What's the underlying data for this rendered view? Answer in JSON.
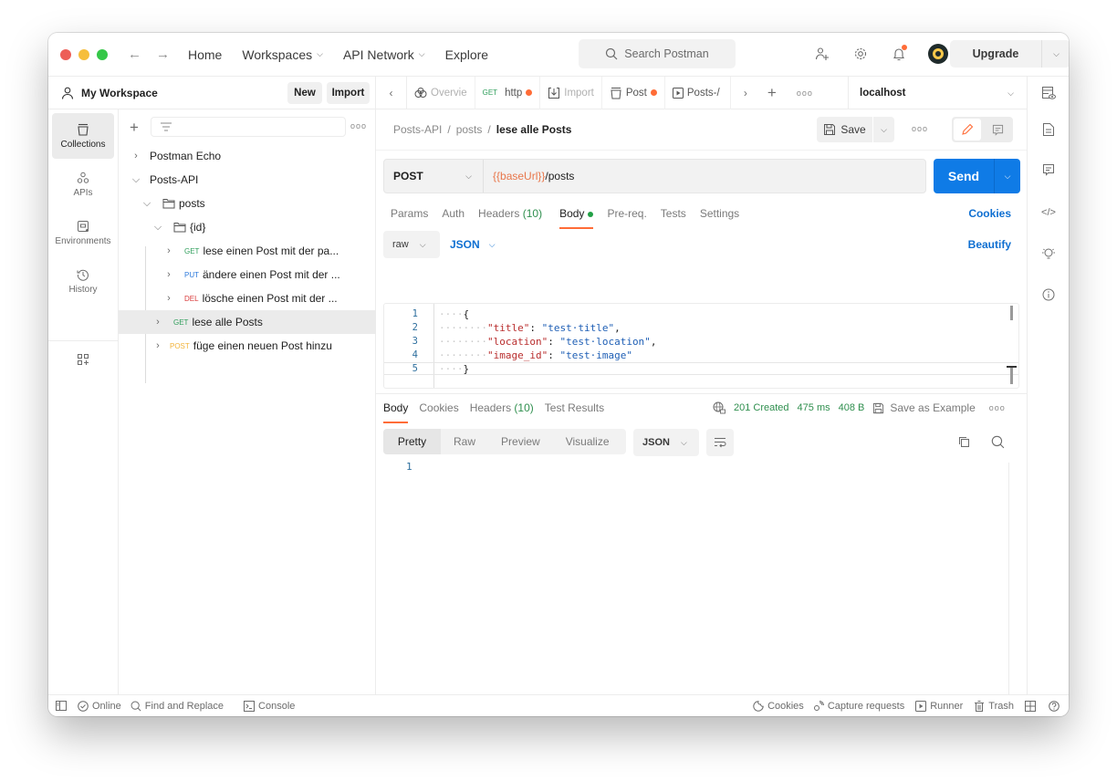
{
  "titlebar": {
    "nav": [
      {
        "label": "Home",
        "has_dropdown": false
      },
      {
        "label": "Workspaces",
        "has_dropdown": true
      },
      {
        "label": "API Network",
        "has_dropdown": true
      },
      {
        "label": "Explore",
        "has_dropdown": false
      }
    ],
    "search_placeholder": "Search Postman",
    "upgrade_label": "Upgrade",
    "icons": [
      "invite-user-icon",
      "settings-gear-icon",
      "notification-bell-icon",
      "avatar"
    ]
  },
  "workspace": {
    "title": "My Workspace",
    "new_label": "New",
    "import_label": "Import"
  },
  "left_rail": [
    {
      "label": "Collections",
      "icon": "collections-icon",
      "active": true
    },
    {
      "label": "APIs",
      "icon": "apis-icon",
      "active": false
    },
    {
      "label": "Environments",
      "icon": "environments-icon",
      "active": false
    },
    {
      "label": "History",
      "icon": "history-icon",
      "active": false
    }
  ],
  "tree": {
    "items": [
      {
        "label": "Postman Echo",
        "caret": ">",
        "method": ""
      },
      {
        "label": "Posts-API",
        "caret": "v",
        "method": ""
      },
      {
        "label": "posts",
        "caret": "v",
        "method": "",
        "folder": true
      },
      {
        "label": "{id}",
        "caret": "v",
        "method": "",
        "folder": true
      },
      {
        "label": "lese einen Post mit der pa...",
        "caret": ">",
        "method": "GET"
      },
      {
        "label": "ändere einen Post mit der ...",
        "caret": ">",
        "method": "PUT"
      },
      {
        "label": "lösche einen Post mit der ...",
        "caret": ">",
        "method": "DEL"
      },
      {
        "label": "lese alle Posts",
        "caret": ">",
        "method": "GET",
        "selected": true
      },
      {
        "label": "füge einen neuen Post hinzu",
        "caret": ">",
        "method": "POST"
      }
    ]
  },
  "tabs": {
    "items": [
      {
        "label": "Overvie",
        "method": "",
        "icon": "overview-icon",
        "unsaved": false
      },
      {
        "label": "http",
        "method": "GET",
        "icon": "",
        "unsaved": true
      },
      {
        "label": "Import",
        "method": "",
        "icon": "import-icon",
        "unsaved": false
      },
      {
        "label": "Post",
        "method": "",
        "icon": "collection-icon",
        "unsaved": true
      },
      {
        "label": "Posts-/",
        "method": "",
        "icon": "runner-icon",
        "unsaved": false
      }
    ],
    "environment": "localhost"
  },
  "request": {
    "breadcrumb": [
      "Posts-API",
      "posts",
      "lese alle Posts"
    ],
    "save_label": "Save",
    "method": "POST",
    "url_variable": "{{baseUrl}}",
    "url_path": "/posts",
    "send_label": "Send",
    "tabs": [
      {
        "label": "Params"
      },
      {
        "label": "Auth"
      },
      {
        "label": "Headers",
        "count": "(10)"
      },
      {
        "label": "Body",
        "active": true,
        "dot": true
      },
      {
        "label": "Pre-req."
      },
      {
        "label": "Tests"
      },
      {
        "label": "Settings"
      }
    ],
    "cookies_label": "Cookies",
    "body_type": "raw",
    "body_format": "JSON",
    "beautify_label": "Beautify",
    "body_lines": [
      {
        "n": "1",
        "indent": "····",
        "key": "",
        "value": "",
        "text": "{"
      },
      {
        "n": "2",
        "indent": "········",
        "key": "\"title\"",
        "value": "\"test·title\"",
        "text": ","
      },
      {
        "n": "3",
        "indent": "········",
        "key": "\"location\"",
        "value": "\"test·location\"",
        "text": ","
      },
      {
        "n": "4",
        "indent": "········",
        "key": "\"image_id\"",
        "value": "\"test·image\"",
        "text": ""
      },
      {
        "n": "5",
        "indent": "····",
        "key": "",
        "value": "",
        "text": "}"
      }
    ]
  },
  "response": {
    "tabs": [
      {
        "label": "Body",
        "active": true
      },
      {
        "label": "Cookies"
      },
      {
        "label": "Headers",
        "count": "(10)"
      },
      {
        "label": "Test Results"
      }
    ],
    "status": "201 Created",
    "time": "475 ms",
    "size": "408 B",
    "save_example_label": "Save as Example",
    "view_tabs": [
      "Pretty",
      "Raw",
      "Preview",
      "Visualize"
    ],
    "format": "JSON",
    "line_numbers": [
      "1"
    ]
  },
  "statusbar": {
    "left": [
      "Online",
      "Find and Replace",
      "Console"
    ],
    "right": [
      "Cookies",
      "Capture requests",
      "Runner",
      "Trash"
    ]
  },
  "colors": {
    "accent": "#ff6c37",
    "send": "#0f7be6",
    "get": "#2f9e5b",
    "put": "#2f7bdc",
    "del": "#d93b3b",
    "post": "#f2b33a",
    "status_ok": "#2f8f4e"
  }
}
